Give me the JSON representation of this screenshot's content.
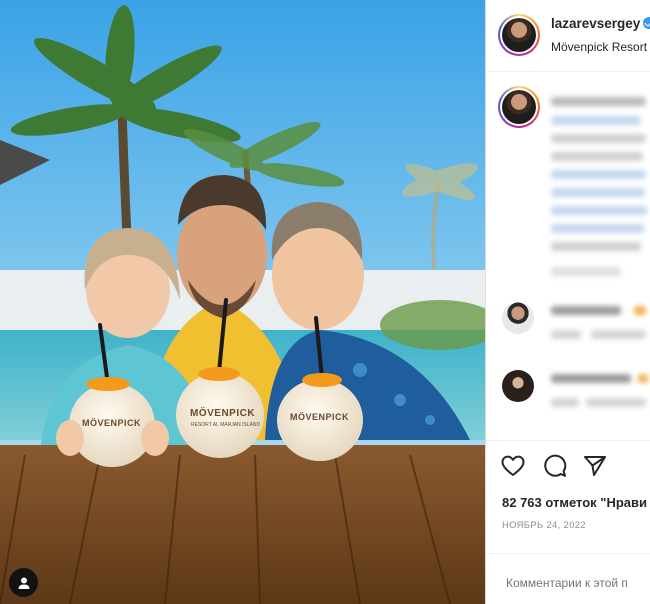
{
  "post": {
    "username": "lazarevsergey",
    "location": "Mövenpick Resort",
    "likes_text": "82 763 отметок \"Нрави",
    "date_text": "НОЯБРЬ 24, 2022",
    "comment_placeholder": "Комментарии к этой п"
  },
  "photo": {
    "cup_brand": "MÖVENPICK",
    "cup_subtitle": "RESORT AL MARJAN ISLAND"
  },
  "icons": {
    "like": "heart-icon",
    "comment": "comment-bubble-icon",
    "share": "paper-plane-icon",
    "tag": "user-tag-icon",
    "verified": "verified-badge-icon"
  },
  "colors": {
    "verified": "#3897f0",
    "text": "#262626",
    "muted": "#8e8e8e",
    "link_blur": "#c3d7ee"
  }
}
